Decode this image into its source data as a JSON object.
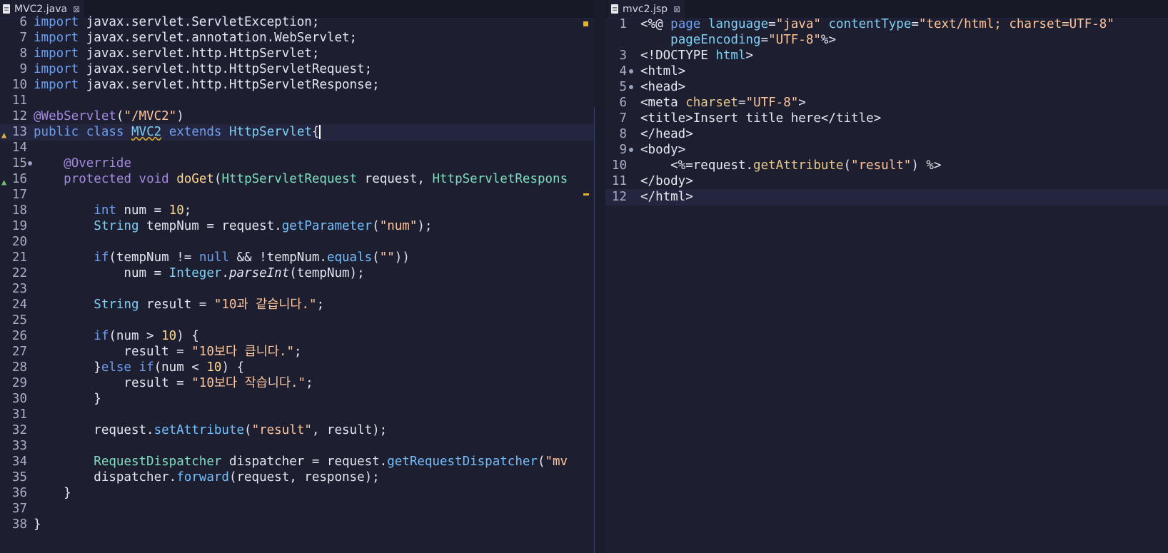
{
  "left_tab": {
    "title": "MVC2.java",
    "close": "⊠"
  },
  "right_tab": {
    "title": "mvc2.jsp",
    "close": "⊠"
  },
  "java_lines": [
    {
      "n": "6",
      "tokens": [
        {
          "t": "import",
          "c": "kw"
        },
        {
          "t": " javax.servlet.ServletException;"
        }
      ]
    },
    {
      "n": "7",
      "tokens": [
        {
          "t": "import",
          "c": "kw"
        },
        {
          "t": " javax.servlet.annotation.WebServlet;"
        }
      ]
    },
    {
      "n": "8",
      "tokens": [
        {
          "t": "import",
          "c": "kw"
        },
        {
          "t": " javax.servlet.http.HttpServlet;"
        }
      ]
    },
    {
      "n": "9",
      "tokens": [
        {
          "t": "import",
          "c": "kw"
        },
        {
          "t": " javax.servlet.http.HttpServletRequest;"
        }
      ]
    },
    {
      "n": "10",
      "tokens": [
        {
          "t": "import",
          "c": "kw"
        },
        {
          "t": " javax.servlet.http.HttpServletResponse;"
        }
      ]
    },
    {
      "n": "11",
      "tokens": []
    },
    {
      "n": "12",
      "tokens": [
        {
          "t": "@WebServlet",
          "c": "ann"
        },
        {
          "t": "("
        },
        {
          "t": "\"/MVC2\"",
          "c": "st"
        },
        {
          "t": ")"
        }
      ]
    },
    {
      "n": "13",
      "cur": true,
      "marker": "warn",
      "tokens": [
        {
          "t": "public",
          "c": "kw"
        },
        {
          "t": " "
        },
        {
          "t": "class",
          "c": "kw"
        },
        {
          "t": " "
        },
        {
          "t": "MVC2",
          "c": "ty squig"
        },
        {
          "t": " "
        },
        {
          "t": "extends",
          "c": "kw"
        },
        {
          "t": " "
        },
        {
          "t": "HttpServlet",
          "c": "ty"
        },
        {
          "t": "{"
        },
        {
          "t": "",
          "c": "caret"
        }
      ]
    },
    {
      "n": "14",
      "tokens": []
    },
    {
      "n": "15",
      "fold": true,
      "tokens": [
        {
          "t": "    "
        },
        {
          "t": "@Override",
          "c": "ann"
        }
      ]
    },
    {
      "n": "16",
      "marker": "override",
      "tokens": [
        {
          "t": "    "
        },
        {
          "t": "protected",
          "c": "kwp"
        },
        {
          "t": " "
        },
        {
          "t": "void",
          "c": "kwp"
        },
        {
          "t": " "
        },
        {
          "t": "doGet",
          "c": "nm"
        },
        {
          "t": "("
        },
        {
          "t": "HttpServletRequest",
          "c": "tc"
        },
        {
          "t": " request, "
        },
        {
          "t": "HttpServletRespons",
          "c": "tc"
        }
      ]
    },
    {
      "n": "17",
      "tokens": []
    },
    {
      "n": "18",
      "tokens": [
        {
          "t": "        "
        },
        {
          "t": "int",
          "c": "kw"
        },
        {
          "t": " num = "
        },
        {
          "t": "10",
          "c": "nm"
        },
        {
          "t": ";"
        }
      ]
    },
    {
      "n": "19",
      "tokens": [
        {
          "t": "        "
        },
        {
          "t": "String",
          "c": "ty"
        },
        {
          "t": " tempNum = request."
        },
        {
          "t": "getParameter",
          "c": "mth"
        },
        {
          "t": "("
        },
        {
          "t": "\"num\"",
          "c": "st"
        },
        {
          "t": ");"
        }
      ]
    },
    {
      "n": "20",
      "tokens": []
    },
    {
      "n": "21",
      "tokens": [
        {
          "t": "        "
        },
        {
          "t": "if",
          "c": "kw"
        },
        {
          "t": "(tempNum != "
        },
        {
          "t": "null",
          "c": "kw"
        },
        {
          "t": " && !tempNum."
        },
        {
          "t": "equals",
          "c": "mth"
        },
        {
          "t": "("
        },
        {
          "t": "\"\"",
          "c": "st"
        },
        {
          "t": "))"
        }
      ]
    },
    {
      "n": "22",
      "tokens": [
        {
          "t": "            num = "
        },
        {
          "t": "Integer",
          "c": "ty"
        },
        {
          "t": "."
        },
        {
          "t": "parseInt",
          "c": "it"
        },
        {
          "t": "(tempNum);"
        }
      ]
    },
    {
      "n": "23",
      "tokens": []
    },
    {
      "n": "24",
      "tokens": [
        {
          "t": "        "
        },
        {
          "t": "String",
          "c": "ty"
        },
        {
          "t": " result = "
        },
        {
          "t": "\"10과 같습니다.\"",
          "c": "st"
        },
        {
          "t": ";"
        }
      ]
    },
    {
      "n": "25",
      "tokens": []
    },
    {
      "n": "26",
      "tokens": [
        {
          "t": "        "
        },
        {
          "t": "if",
          "c": "kw"
        },
        {
          "t": "(num > "
        },
        {
          "t": "10",
          "c": "nm"
        },
        {
          "t": ") {"
        }
      ]
    },
    {
      "n": "27",
      "tokens": [
        {
          "t": "            result = "
        },
        {
          "t": "\"10보다 큽니다.\"",
          "c": "st"
        },
        {
          "t": ";"
        }
      ]
    },
    {
      "n": "28",
      "tokens": [
        {
          "t": "        }"
        },
        {
          "t": "else",
          "c": "kw"
        },
        {
          "t": " "
        },
        {
          "t": "if",
          "c": "kw"
        },
        {
          "t": "(num < "
        },
        {
          "t": "10",
          "c": "nm"
        },
        {
          "t": ") {"
        }
      ]
    },
    {
      "n": "29",
      "tokens": [
        {
          "t": "            result = "
        },
        {
          "t": "\"10보다 작습니다.\"",
          "c": "st"
        },
        {
          "t": ";"
        }
      ]
    },
    {
      "n": "30",
      "tokens": [
        {
          "t": "        }"
        }
      ]
    },
    {
      "n": "31",
      "tokens": []
    },
    {
      "n": "32",
      "tokens": [
        {
          "t": "        request."
        },
        {
          "t": "setAttribute",
          "c": "mth"
        },
        {
          "t": "("
        },
        {
          "t": "\"result\"",
          "c": "st"
        },
        {
          "t": ", result);"
        }
      ]
    },
    {
      "n": "33",
      "tokens": []
    },
    {
      "n": "34",
      "tokens": [
        {
          "t": "        "
        },
        {
          "t": "RequestDispatcher",
          "c": "tc"
        },
        {
          "t": " dispatcher = request."
        },
        {
          "t": "getRequestDispatcher",
          "c": "mth"
        },
        {
          "t": "("
        },
        {
          "t": "\"mv",
          "c": "st"
        }
      ]
    },
    {
      "n": "35",
      "tokens": [
        {
          "t": "        dispatcher."
        },
        {
          "t": "forward",
          "c": "mth"
        },
        {
          "t": "(request, response);"
        }
      ]
    },
    {
      "n": "36",
      "tokens": [
        {
          "t": "    }"
        }
      ]
    },
    {
      "n": "37",
      "tokens": []
    },
    {
      "n": "38",
      "tokens": [
        {
          "t": "}"
        }
      ]
    }
  ],
  "jsp_lines": [
    {
      "n": "1",
      "tokens": [
        {
          "t": "<%@ "
        },
        {
          "t": "page",
          "c": "kw"
        },
        {
          "t": " "
        },
        {
          "t": "language",
          "c": "ty"
        },
        {
          "t": "="
        },
        {
          "t": "\"java\"",
          "c": "st"
        },
        {
          "t": " "
        },
        {
          "t": "contentType",
          "c": "ty"
        },
        {
          "t": "="
        },
        {
          "t": "\"text/html; charset=UTF-8\"",
          "c": "st"
        }
      ]
    },
    {
      "n": "",
      "tokens": [
        {
          "t": "    "
        },
        {
          "t": "pageEncoding",
          "c": "ty"
        },
        {
          "t": "="
        },
        {
          "t": "\"UTF-8\"",
          "c": "st"
        },
        {
          "t": "%>"
        }
      ]
    },
    {
      "n": "3",
      "tokens": [
        {
          "t": "<!DOCTYPE "
        },
        {
          "t": "html",
          "c": "ty"
        },
        {
          "t": ">"
        }
      ]
    },
    {
      "n": "4",
      "fold": true,
      "tokens": [
        {
          "t": "<html>"
        }
      ]
    },
    {
      "n": "5",
      "fold": true,
      "tokens": [
        {
          "t": "<head>"
        }
      ]
    },
    {
      "n": "6",
      "tokens": [
        {
          "t": "<meta "
        },
        {
          "t": "charset",
          "c": "attr"
        },
        {
          "t": "="
        },
        {
          "t": "\"UTF-8\"",
          "c": "st"
        },
        {
          "t": ">"
        }
      ]
    },
    {
      "n": "7",
      "tokens": [
        {
          "t": "<title>"
        },
        {
          "t": "Insert title here"
        },
        {
          "t": "</title>"
        }
      ]
    },
    {
      "n": "8",
      "tokens": [
        {
          "t": "</head>"
        }
      ]
    },
    {
      "n": "9",
      "fold": true,
      "tokens": [
        {
          "t": "<body>"
        }
      ]
    },
    {
      "n": "10",
      "tokens": [
        {
          "t": "    <%=request."
        },
        {
          "t": "getAttribute",
          "c": "attr"
        },
        {
          "t": "("
        },
        {
          "t": "\"result\"",
          "c": "st"
        },
        {
          "t": ") %>"
        }
      ]
    },
    {
      "n": "11",
      "tokens": [
        {
          "t": "</body>"
        }
      ]
    },
    {
      "n": "12",
      "cur": true,
      "tokens": [
        {
          "t": "</html>"
        }
      ]
    }
  ]
}
